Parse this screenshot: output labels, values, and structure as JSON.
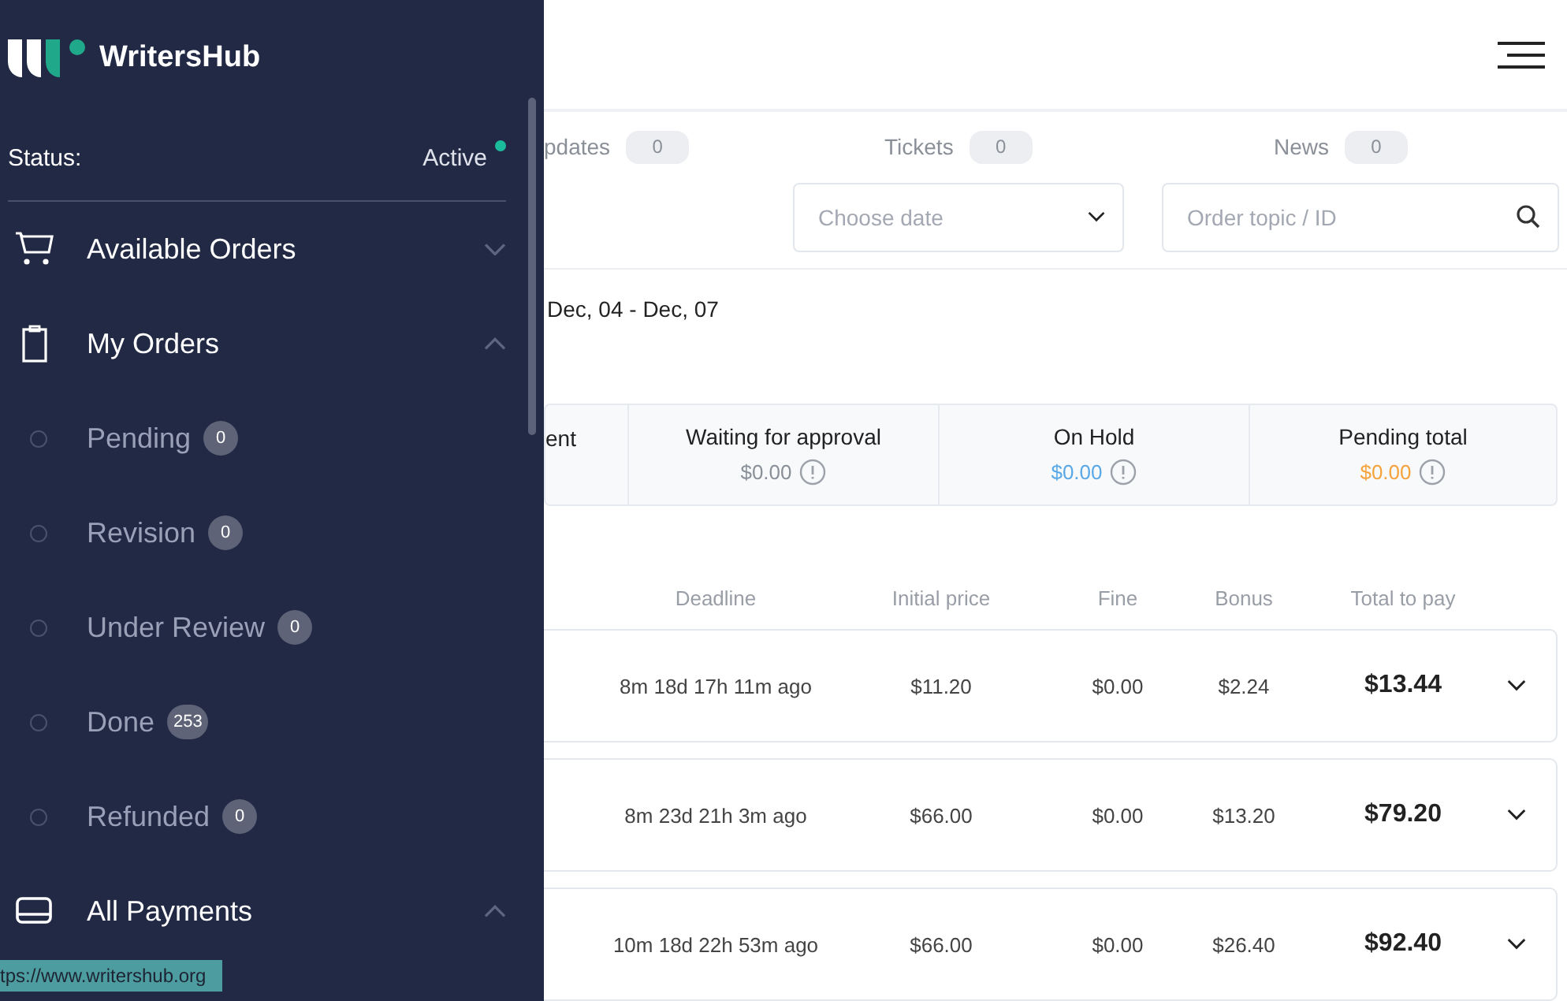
{
  "sidebar": {
    "brand": "WritersHub",
    "status": {
      "label": "Status:",
      "value": "Active",
      "online": true
    },
    "nav": [
      {
        "label": "Available Orders",
        "expanded": false
      },
      {
        "label": "My Orders",
        "expanded": true,
        "children": [
          {
            "label": "Pending",
            "count": "0"
          },
          {
            "label": "Revision",
            "count": "0"
          },
          {
            "label": "Under Review",
            "count": "0"
          },
          {
            "label": "Done",
            "count": "253"
          },
          {
            "label": "Refunded",
            "count": "0"
          }
        ]
      },
      {
        "label": "All Payments",
        "expanded": true
      }
    ]
  },
  "tabs": [
    {
      "label": "pdates",
      "count": "0"
    },
    {
      "label": "Tickets",
      "count": "0"
    },
    {
      "label": "News",
      "count": "0"
    }
  ],
  "filters": {
    "date": {
      "placeholder": "Choose date"
    },
    "search": {
      "placeholder": "Order topic / ID"
    }
  },
  "period": "Dec, 04 - Dec, 07",
  "summary": [
    {
      "label": "ent"
    },
    {
      "label": "Waiting for approval",
      "value": "$0.00",
      "color": "#8a9099"
    },
    {
      "label": "On Hold",
      "value": "$0.00",
      "color": "#5aa9e6"
    },
    {
      "label": "Pending total",
      "value": "$0.00",
      "color": "#f5a33b"
    }
  ],
  "table": {
    "columns": [
      "Deadline",
      "Initial price",
      "Fine",
      "Bonus",
      "Total to pay"
    ],
    "rows": [
      [
        "8m 18d 17h 11m ago",
        "$11.20",
        "$0.00",
        "$2.24",
        "$13.44"
      ],
      [
        "8m 23d 21h 3m ago",
        "$66.00",
        "$0.00",
        "$13.20",
        "$79.20"
      ],
      [
        "10m 18d 22h 53m ago",
        "$66.00",
        "$0.00",
        "$26.40",
        "$92.40"
      ]
    ]
  },
  "status_bar": "tps://www.writershub.org"
}
